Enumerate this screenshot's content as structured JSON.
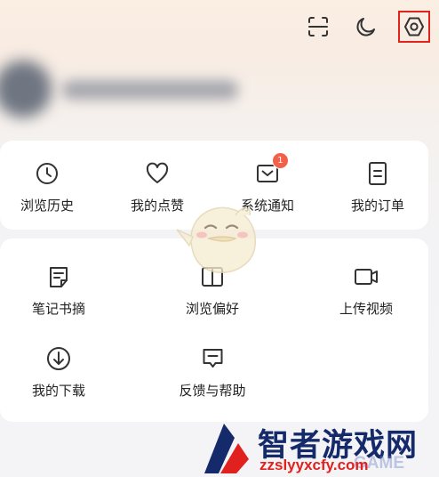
{
  "top_icons": {
    "scan": "scan-icon",
    "dark_mode": "moon-icon",
    "settings": "settings-hexagon-icon"
  },
  "quick_actions": [
    {
      "label": "浏览历史",
      "icon": "clock-icon"
    },
    {
      "label": "我的点赞",
      "icon": "heart-icon"
    },
    {
      "label": "系统通知",
      "icon": "mail-icon",
      "badge": "1"
    },
    {
      "label": "我的订单",
      "icon": "document-icon"
    }
  ],
  "tools": [
    {
      "label": "笔记书摘",
      "icon": "note-icon"
    },
    {
      "label": "浏览偏好",
      "icon": "book-icon"
    },
    {
      "label": "上传视频",
      "icon": "video-camera-icon"
    },
    {
      "label": "我的下载",
      "icon": "download-icon"
    },
    {
      "label": "反馈与帮助",
      "icon": "feedback-icon"
    }
  ],
  "watermark": {
    "title": "智者游戏网",
    "url": "zzslyyxcfy.com",
    "sub": "GAME"
  },
  "colors": {
    "badge": "#f2604a",
    "highlight_box": "#e0231d",
    "watermark_title": "#152a6b",
    "watermark_url": "#e1211d"
  }
}
